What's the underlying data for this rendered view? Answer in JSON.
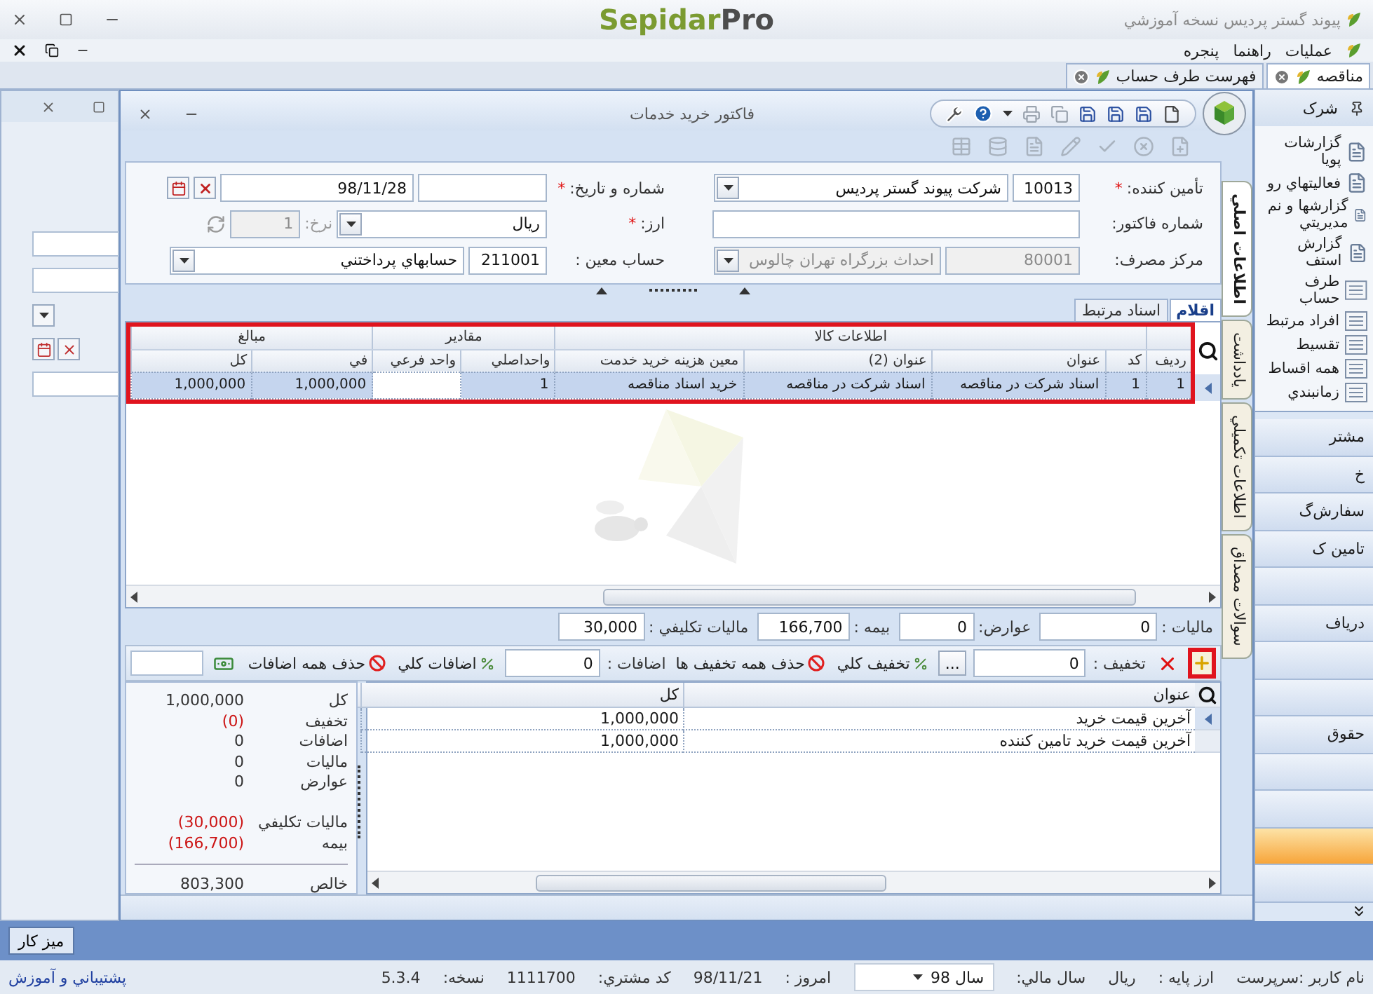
{
  "app": {
    "title": "پيوند گستر پرديس نسخه آموزشي",
    "logo": {
      "main": "Sepidar",
      "accent": "Pro"
    }
  },
  "menu": [
    {
      "label": "عمليات"
    },
    {
      "label": "راهنما"
    },
    {
      "label": "پنجره"
    }
  ],
  "doc_tabs": [
    {
      "label": "مناقصه",
      "selected": true
    },
    {
      "label": "فهرست طرف حساب",
      "selected": false
    }
  ],
  "dialog": {
    "title": "فاکتور خريد خدمات",
    "form": {
      "supplier": {
        "label": "تأمين کننده:",
        "mark": "*",
        "code": "10013",
        "name": "شرکت پيوند گستر پرديس"
      },
      "invoice_no": {
        "label": "شماره فاکتور:"
      },
      "cost_center": {
        "label": "مرکز مصرف:",
        "code": "80001",
        "name": "احداث بزرگراه تهران چالوس",
        "disabled": true
      },
      "number_date": {
        "label": "شماره و تاريخ:",
        "mark": "*",
        "date": "98/11/28"
      },
      "currency": {
        "label": "ارز:",
        "mark": "*",
        "value": "ريال",
        "rate_label": "نرخ:",
        "rate": "1",
        "rate_disabled": true
      },
      "account": {
        "label": "حساب معين :",
        "code": "211001",
        "name": "حسابهاي پرداختني"
      }
    },
    "side_tabs": [
      {
        "label": "اطلاعات اصلي",
        "selected": true
      },
      {
        "label": "يادداشت",
        "selected": false
      },
      {
        "label": "اطلاعات تکميلي",
        "selected": false
      },
      {
        "label": "سوالات مصداق",
        "selected": false
      }
    ],
    "item_tabs": [
      {
        "label": "اقلام",
        "selected": true
      },
      {
        "label": "اسناد مرتبط",
        "selected": false
      }
    ],
    "grid": {
      "highlight": true,
      "groups": [
        {
          "columns": [
            "رديف"
          ]
        },
        {
          "label": "اطلاعات کالا",
          "columns": [
            "کد",
            "عنوان",
            "عنوان (2)",
            "معين هزينه خريد خدمت"
          ]
        },
        {
          "label": "مقادير",
          "columns": [
            "واحداصلي",
            "واحد فرعي"
          ]
        },
        {
          "label": "مبالغ",
          "columns": [
            "في",
            "کل"
          ]
        }
      ],
      "rows": [
        {
          "selected": true,
          "cells": [
            "1",
            "1",
            "اسناد شرکت در مناقصه",
            "اسناد شرکت در مناقصه",
            "خريد اسناد مناقصه",
            "1",
            null,
            "1,000,000",
            "1,000,000"
          ]
        }
      ]
    },
    "totals": [
      {
        "label": "ماليات :",
        "value": "0"
      },
      {
        "label": "عوارض:",
        "value": "0"
      },
      {
        "label": "بيمه :",
        "value": "166,700"
      },
      {
        "label": "ماليات تکليفي :",
        "value": "30,000"
      }
    ],
    "actions": {
      "add_highlight": true,
      "discount_label": "تخفيف :",
      "discount": "0",
      "more": "...",
      "discount_all": "تخفيف کلي",
      "remove_discounts": "حذف همه تخفيف ها",
      "additions_label": "اضافات :",
      "additions": "0",
      "additions_all": "اضافات کلي",
      "remove_additions": "حذف همه اضافات"
    },
    "price_grid": {
      "columns": [
        "عنوان",
        "کل"
      ],
      "rows": [
        {
          "selected": true,
          "cells": [
            "آخرين قيمت خريد",
            "1,000,000"
          ]
        },
        {
          "selected": false,
          "cells": [
            "آخرين قيمت خريد تامين کننده",
            "1,000,000"
          ]
        }
      ]
    },
    "summary": {
      "items": [
        {
          "label": "کل",
          "value": "1,000,000",
          "negative": false
        },
        {
          "label": "تخفيف",
          "value": "(0)",
          "negative": true
        },
        {
          "label": "اضافات",
          "value": "0",
          "negative": false
        },
        {
          "label": "ماليات",
          "value": "0",
          "negative": false
        },
        {
          "label": "عوارض",
          "value": "0",
          "negative": false
        }
      ],
      "deductions": [
        {
          "label": "ماليات تکليفي",
          "value": "(30,000)",
          "negative": true
        },
        {
          "label": "بيمه",
          "value": "(166,700)",
          "negative": true
        }
      ],
      "net": {
        "label": "خالص",
        "value": "803,300"
      }
    }
  },
  "sidebar": {
    "title": "شرک",
    "items": [
      {
        "label": "گزارشات پويا",
        "kind": "report"
      },
      {
        "label": "فعاليتهاي رو",
        "kind": "report"
      },
      {
        "label": "گزارشها و نم مديريتي",
        "kind": "report"
      },
      {
        "label": "گزارش استف",
        "kind": "report"
      },
      {
        "label": "طرف حساب",
        "kind": "list"
      },
      {
        "label": "افراد مرتبط",
        "kind": "list"
      },
      {
        "label": "تقسيط",
        "kind": "list"
      },
      {
        "label": "همه اقساط",
        "kind": "list"
      },
      {
        "label": "زمانبندي",
        "kind": "list"
      }
    ],
    "bars": [
      {
        "label": "مشتر",
        "selected": false
      },
      {
        "label": "خ",
        "selected": false
      },
      {
        "label": "سفارش‌گ",
        "selected": false
      },
      {
        "label": "تامين ک",
        "selected": false
      },
      {
        "selected": false
      },
      {
        "label": "درياف",
        "selected": false
      },
      {
        "selected": false
      },
      {
        "selected": false
      },
      {
        "label": "حقوق",
        "selected": false
      },
      {
        "selected": false
      },
      {
        "selected": false
      },
      {
        "selected": true
      },
      {
        "selected": false
      }
    ]
  },
  "desk_button": "ميز کار",
  "status": {
    "user": "نام کاربر :سرپرست",
    "base_currency_label": "ارز پايه :",
    "base_currency": "ريال",
    "fiscal_year_label": "سال مالي:",
    "fiscal_year": "سال 98",
    "today_label": "امروز :",
    "today": "98/11/21",
    "customer_code_label": "کد مشتري:",
    "customer_code": "1111700",
    "version_label": "نسخه:",
    "version": "5.3.4",
    "support": "پشتيباني و آموزش"
  }
}
